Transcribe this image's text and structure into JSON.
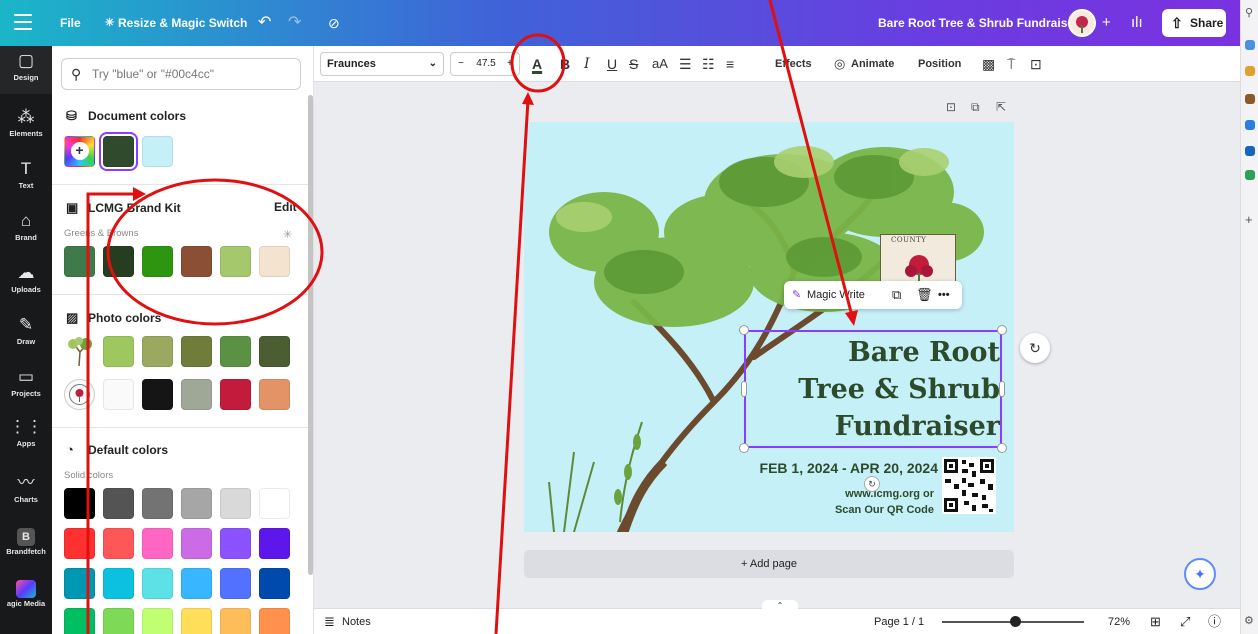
{
  "topbar": {
    "file": "File",
    "resize": "Resize & Magic Switch",
    "design_title": "Bare Root Tree & Shrub Fundraiser",
    "add": "+",
    "share": "Share"
  },
  "rail": [
    {
      "icon": "▢",
      "label": "Design"
    },
    {
      "icon": "⁂",
      "label": "Elements"
    },
    {
      "icon": "T",
      "label": "Text"
    },
    {
      "icon": "⌂",
      "label": "Brand"
    },
    {
      "icon": "☁",
      "label": "Uploads"
    },
    {
      "icon": "✎",
      "label": "Draw"
    },
    {
      "icon": "▭",
      "label": "Projects"
    },
    {
      "icon": "⋮⋮",
      "label": "Apps"
    },
    {
      "icon": "〰",
      "label": "Charts"
    },
    {
      "icon": "B",
      "label": "Brandfetch"
    },
    {
      "icon": "▦",
      "label": "agic Media"
    }
  ],
  "panel": {
    "search_placeholder": "Try \"blue\" or \"#00c4cc\"",
    "document_colors": {
      "title": "Document colors",
      "add": "+",
      "colors": [
        "#2f4a2c",
        "#c6f0f8"
      ]
    },
    "brand_kit": {
      "title": "LCMG Brand Kit",
      "edit": "Edit",
      "palette_name": "Greens & Browns",
      "colors": [
        "#3f7a4a",
        "#263d1f",
        "#2e9510",
        "#8a4f35",
        "#a4c86b",
        "#f3e3cf"
      ]
    },
    "photo_colors": {
      "title": "Photo colors",
      "rows": [
        [
          "#9ec85e",
          "#9aa860",
          "#6f7c3a",
          "#5a9143",
          "#4a5e32"
        ],
        [
          "#fafafa",
          "#151515",
          "#9fa796",
          "#c21b3c",
          "#e39466"
        ]
      ]
    },
    "default_colors": {
      "title": "Default colors",
      "subtitle": "Solid colors",
      "rows": [
        [
          "#000000",
          "#545454",
          "#737373",
          "#a6a6a6",
          "#d9d9d9",
          "#ffffff"
        ],
        [
          "#ff3131",
          "#ff5757",
          "#ff66c4",
          "#cb6ce6",
          "#8c52ff",
          "#5e17eb"
        ],
        [
          "#0097b2",
          "#0cc0df",
          "#5ce1e6",
          "#38b6ff",
          "#5271ff",
          "#004aad"
        ],
        [
          "#00bf63",
          "#7ed957",
          "#c1ff72",
          "#ffde59",
          "#ffbd59",
          "#ff914d"
        ]
      ]
    }
  },
  "toolbar": {
    "font": "Fraunces",
    "minus": "−",
    "size": "47.5",
    "plus": "+",
    "text_color_glyph": "A",
    "bold": "B",
    "italic": "I",
    "underline": "U",
    "strike": "S",
    "case": "aA",
    "effects": "Effects",
    "animate": "Animate",
    "position": "Position"
  },
  "canvas": {
    "headline_line1": "Bare Root",
    "headline_line2": "Tree & Shrub",
    "headline_line3": "Fundraiser",
    "dates": "FEB 1, 2024 - APR 20, 2024",
    "website": "www.lcmg.org or",
    "qr_text": "Scan Our QR Code",
    "logo_text": "COUNTY",
    "magic_write": "Magic Write",
    "add_page": "+ Add page"
  },
  "footer": {
    "notes": "Notes",
    "page": "Page 1 / 1",
    "zoom": "72%"
  }
}
